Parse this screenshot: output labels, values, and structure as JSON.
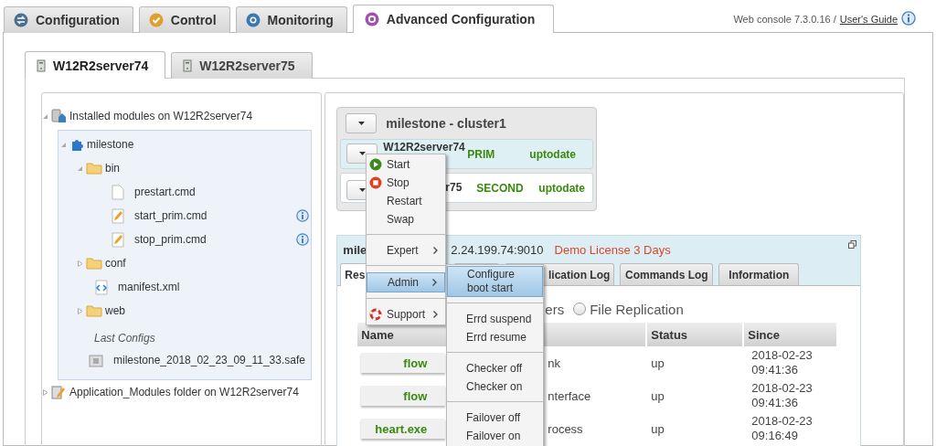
{
  "top_tabs": [
    {
      "label": "Configuration",
      "kind": "configuration",
      "selected": false
    },
    {
      "label": "Control",
      "kind": "control",
      "selected": false
    },
    {
      "label": "Monitoring",
      "kind": "monitoring",
      "selected": false
    },
    {
      "label": "Advanced Configuration",
      "kind": "advanced",
      "selected": true
    }
  ],
  "version_text": "Web console 7.3.0.16 /",
  "guide_link": "User's Guide",
  "server_tabs": [
    {
      "label": "W12R2server74",
      "selected": true
    },
    {
      "label": "W12R2server75",
      "selected": false
    }
  ],
  "tree": [
    {
      "label": "Installed modules on W12R2server74",
      "kind": "server",
      "expanded": true,
      "children": [
        {
          "label": "milestone",
          "kind": "module",
          "expanded": true,
          "children": [
            {
              "label": "bin",
              "kind": "folder",
              "expanded": true,
              "children": [
                {
                  "label": "prestart.cmd",
                  "kind": "file",
                  "info": false
                },
                {
                  "label": "start_prim.cmd",
                  "kind": "script",
                  "info": true
                },
                {
                  "label": "stop_prim.cmd",
                  "kind": "script",
                  "info": true
                }
              ]
            },
            {
              "label": "conf",
              "kind": "folder",
              "expanded": false
            },
            {
              "label": "manifest.xml",
              "kind": "xml",
              "info": false
            },
            {
              "label": "web",
              "kind": "folder",
              "expanded": false
            }
          ],
          "last_configs": {
            "title": "Last Configs",
            "items": [
              {
                "label": "milestone_2018_02_23_09_11_33.safe",
                "kind": "archive"
              }
            ]
          }
        }
      ]
    },
    {
      "label": "Application_Modules folder on W12R2server74",
      "kind": "app-folder",
      "expanded": false
    }
  ],
  "cluster": {
    "title": "milestone - cluster1",
    "rows": [
      {
        "name": "W12R2server74",
        "role": "PRIM",
        "state": "uptodate",
        "selected": true
      },
      {
        "name": "r75",
        "role": "SECOND",
        "state": "uptodate",
        "selected": false
      }
    ]
  },
  "module": {
    "title": "mile",
    "address": "2.24.199.74:9010",
    "license": "Demo License 3 Days",
    "tabs": [
      {
        "label": "Res",
        "selected": true
      },
      {
        "selected": false
      },
      {
        "label": "lication Log",
        "selected": false
      },
      {
        "label": "Commands Log",
        "selected": false
      },
      {
        "label": "Information",
        "selected": false
      }
    ],
    "radio_fragment": "ers",
    "radio_options": [
      {
        "label": "File Replication",
        "selected": false
      }
    ],
    "columns": [
      "Name",
      null,
      "Status",
      "Since"
    ],
    "rows": [
      {
        "name": "flow",
        "description": "nk",
        "status": "up",
        "since": "2018-02-23 09:41:36"
      },
      {
        "name": "flow",
        "description": "nterface",
        "status": "up",
        "since": "2018-02-23 09:41:36"
      },
      {
        "name": "heart.exe",
        "description": "rocess",
        "status": "up",
        "since": "2018-02-23 09:16:49"
      }
    ]
  },
  "context_menu": [
    {
      "label": "Start",
      "kind": "start",
      "selected": false
    },
    {
      "label": "Stop",
      "kind": "stop",
      "selected": false
    },
    {
      "label": "Restart",
      "kind": "plain",
      "selected": false
    },
    {
      "label": "Swap",
      "kind": "plain",
      "selected": false
    },
    {
      "kind": "separator"
    },
    {
      "label": "Expert",
      "kind": "submenu",
      "selected": false
    },
    {
      "kind": "separator"
    },
    {
      "label": "Admin",
      "kind": "submenu",
      "selected": true
    },
    {
      "kind": "separator"
    },
    {
      "label": "Support",
      "kind": "support",
      "selected": false
    }
  ],
  "submenu": [
    {
      "label": "Configure boot start",
      "kind": "plain",
      "selected": true
    },
    {
      "kind": "separator"
    },
    {
      "label": "Errd suspend",
      "kind": "plain",
      "selected": false
    },
    {
      "label": "Errd resume",
      "kind": "plain",
      "selected": false
    },
    {
      "kind": "separator"
    },
    {
      "label": "Checker off",
      "kind": "plain",
      "selected": false
    },
    {
      "label": "Checker on",
      "kind": "plain",
      "selected": false
    },
    {
      "kind": "separator"
    },
    {
      "label": "Failover off",
      "kind": "plain",
      "selected": false
    },
    {
      "label": "Failover on",
      "kind": "plain",
      "selected": false
    }
  ]
}
